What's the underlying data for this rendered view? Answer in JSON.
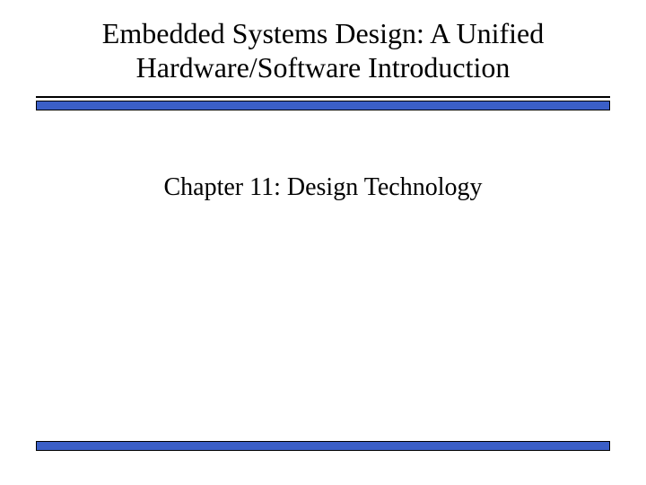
{
  "title": {
    "line1": "Embedded Systems Design: A Unified",
    "line2": "Hardware/Software Introduction"
  },
  "chapter": "Chapter 11: Design Technology",
  "colors": {
    "bar": "#3b5fc7",
    "border": "#000000",
    "text": "#000000",
    "background": "#ffffff"
  }
}
